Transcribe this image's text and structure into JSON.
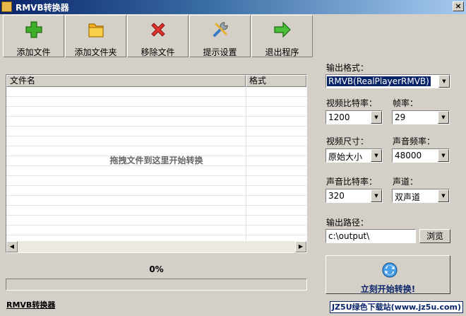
{
  "window": {
    "title": "RMVB转换器",
    "close_label": "×"
  },
  "toolbar": {
    "add_file": "添加文件",
    "add_folder": "添加文件夹",
    "remove_file": "移除文件",
    "settings": "提示设置",
    "exit": "退出程序"
  },
  "file_list": {
    "columns": [
      "文件名",
      "格式"
    ],
    "hint": "拖拽文件到这里开始转换",
    "rows": []
  },
  "progress": {
    "label": "0%",
    "value": 0
  },
  "status": {
    "app_name": "RMVB转换器"
  },
  "settings": {
    "output_format_label": "输出格式：",
    "output_format_value": "RMVB(RealPlayerRMVB)",
    "video_bitrate_label": "视频比特率：",
    "video_bitrate_value": "1200",
    "frame_rate_label": "帧率：",
    "frame_rate_value": "29",
    "video_size_label": "视频尺寸：",
    "video_size_value": "原始大小",
    "audio_freq_label": "声音频率：",
    "audio_freq_value": "48000",
    "audio_bitrate_label": "声音比特率：",
    "audio_bitrate_value": "320",
    "channel_label": "声道：",
    "channel_value": "双声道",
    "output_path_label": "输出路径：",
    "output_path_value": "c:\\output\\",
    "browse_label": "浏览",
    "start_label": "立刻开始转换!"
  },
  "banner": {
    "text": "JZ5U绿色下载站(www.jz5u.com)"
  },
  "icons": {
    "add": "plus-icon",
    "folder": "folder-icon",
    "remove": "x-icon",
    "settings": "tools-icon",
    "exit": "arrow-right-icon",
    "start": "convert-icon"
  }
}
